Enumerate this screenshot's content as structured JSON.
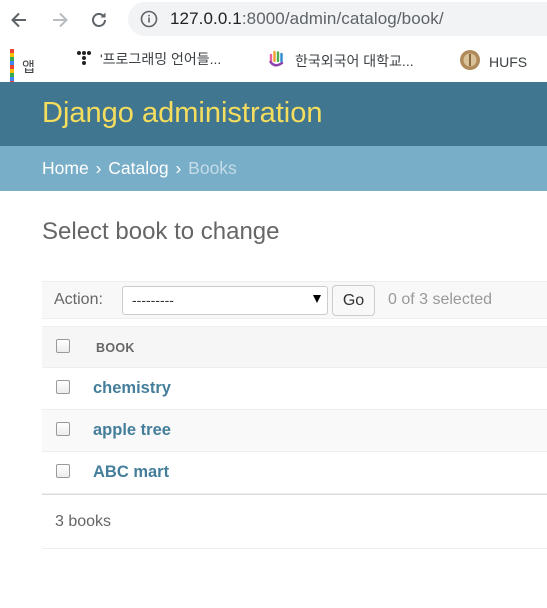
{
  "browser": {
    "url_host": "127.0.0.1",
    "url_path": ":8000/admin/catalog/book/",
    "bookmarks": [
      {
        "label": "앱",
        "icon": "apps-grid-icon"
      },
      {
        "label": "'프로그래밍 언어들...",
        "icon": "tistory-icon"
      },
      {
        "label": "한국외국어 대학교...",
        "icon": "hand-logo-icon"
      },
      {
        "label": "HUFS",
        "icon": "hufs-seal-icon"
      }
    ]
  },
  "header": {
    "brand": "Django administration",
    "brand_color": "#f5dd5d",
    "header_color": "#417690",
    "breadcrumb_color": "#79aec8"
  },
  "breadcrumbs": {
    "home": "Home",
    "separator": "›",
    "app": "Catalog",
    "current": "Books"
  },
  "page": {
    "title": "Select book to change"
  },
  "actions": {
    "label": "Action:",
    "selected_option": "---------",
    "go_label": "Go",
    "counter": "0 of 3 selected"
  },
  "table": {
    "column_header": "BOOK",
    "rows": [
      {
        "title": "chemistry"
      },
      {
        "title": "apple tree"
      },
      {
        "title": "ABC mart"
      }
    ]
  },
  "paginator": {
    "text": "3 books"
  }
}
